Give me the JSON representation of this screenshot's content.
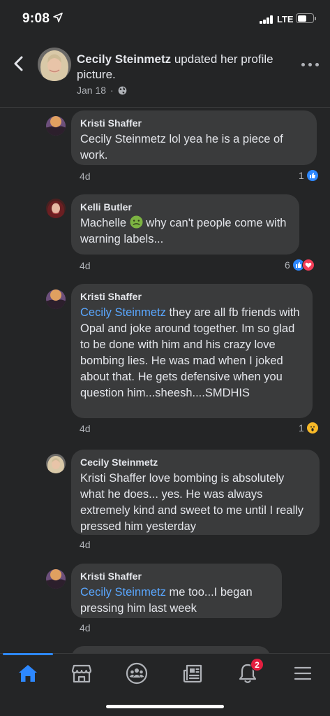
{
  "status_bar": {
    "time": "9:08",
    "network": "LTE"
  },
  "header": {
    "name": "Cecily Steinmetz",
    "action": " updated her profile picture.",
    "date": "Jan 18",
    "separator": "·"
  },
  "comments": [
    {
      "author": "Kristi Shaffer",
      "mention": "",
      "text": "Cecily Steinmetz lol yea he is a piece of work.",
      "time": "4d",
      "reaction_count": "1",
      "reactions": [
        "like-icon"
      ]
    },
    {
      "author": "Kelli Butler",
      "mention": "",
      "text_before_emoji": "Machelle ",
      "emoji": "nauseated-face-emoji",
      "text_after_emoji": " why can't people come with warning labels...",
      "time": "4d",
      "reaction_count": "6",
      "reactions": [
        "like-icon",
        "love-icon"
      ]
    },
    {
      "author": "Kristi Shaffer",
      "mention": "Cecily Steinmetz",
      "text": " they are all fb friends with Opal and joke around together. Im so glad to be done with him and his crazy love bombing lies. He was mad when I joked about that. He gets defensive when you question him...sheesh....SMDHIS",
      "time": "4d",
      "reaction_count": "1",
      "reactions": [
        "wow-icon"
      ]
    },
    {
      "author": "Cecily Steinmetz",
      "mention": "",
      "text": "Kristi Shaffer love bombing is absolutely what he does... yes. He was always extremely kind and sweet to me until I really pressed him yesterday",
      "time": "4d"
    },
    {
      "author": "Kristi Shaffer",
      "mention": "Cecily Steinmetz",
      "text": " me too...I began pressing him last week",
      "time": "4d"
    }
  ],
  "tabbar": {
    "tabs": [
      "home-icon",
      "marketplace-icon",
      "groups-icon",
      "news-icon",
      "notifications-icon",
      "menu-icon"
    ],
    "notification_badge": "2",
    "active_tab": "home-icon"
  },
  "colors": {
    "background": "#242526",
    "bubble": "#3a3b3c",
    "mention": "#5aa7ff",
    "accent": "#2d88ff",
    "badge": "#e41e3f"
  }
}
